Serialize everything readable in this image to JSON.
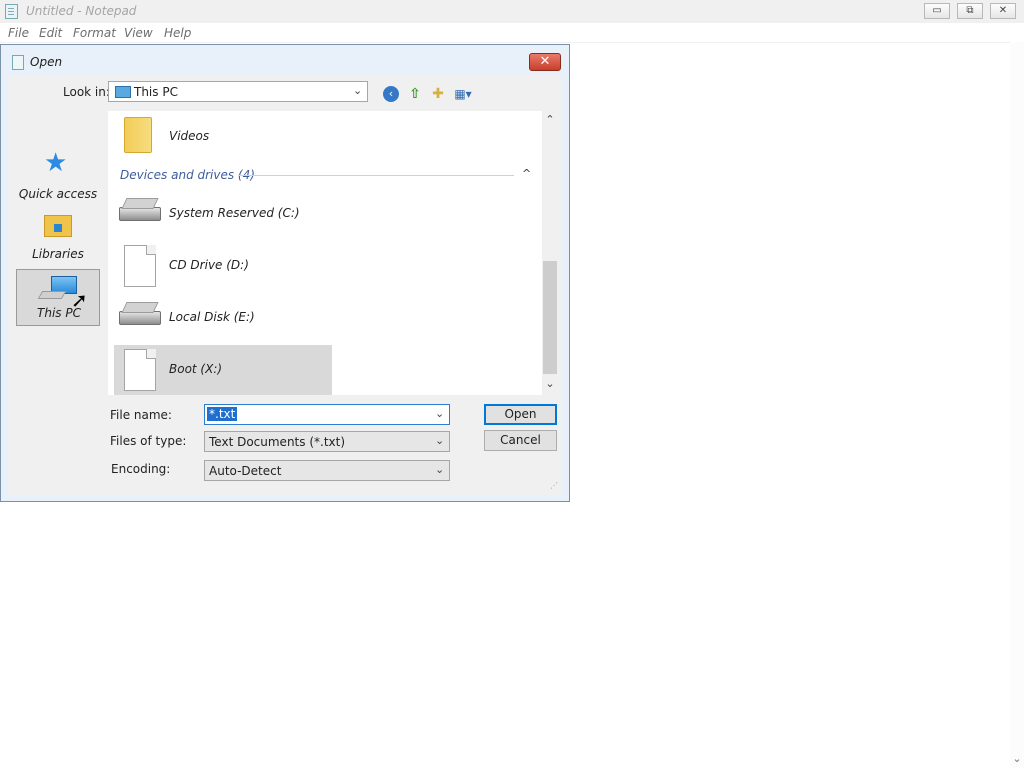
{
  "notepad": {
    "title": "Untitled - Notepad",
    "window_buttons": {
      "minimize": "▭",
      "maximize": "⧉",
      "close": "✕"
    },
    "menu": [
      "File",
      "Edit",
      "Format",
      "View",
      "Help"
    ],
    "scroll_down_glyph": "⌄"
  },
  "dialog": {
    "title": "Open",
    "close_glyph": "✕",
    "look_in": {
      "label": "Look in:",
      "value": "This PC",
      "arrow": "⌄"
    },
    "toolbar_icons": {
      "back": "‹",
      "up": "⇧",
      "new_folder": "✚",
      "views": "▦▾"
    },
    "places": [
      {
        "label": "Quick access",
        "icon": "star-icon"
      },
      {
        "label": "Libraries",
        "icon": "libraries-icon"
      },
      {
        "label": "This PC",
        "icon": "computer-icon",
        "selected": true
      }
    ],
    "items": {
      "videos": "Videos",
      "group_header": "Devices and drives (4)",
      "group_collapse_glyph": "^",
      "drives": [
        {
          "label": "System Reserved (C:)",
          "icon": "hard-drive-icon"
        },
        {
          "label": "CD Drive (D:)",
          "icon": "file-icon"
        },
        {
          "label": "Local Disk (E:)",
          "icon": "hard-drive-icon"
        },
        {
          "label": "Boot (X:)",
          "icon": "file-icon",
          "selected": true
        }
      ]
    },
    "scroll_glyphs": {
      "up": "⌃",
      "down": "⌄"
    },
    "file_name": {
      "label": "File name:",
      "value": "*.txt"
    },
    "files_of_type": {
      "label": "Files of type:",
      "value": "Text Documents (*.txt)"
    },
    "encoding": {
      "label": "Encoding:",
      "value": "Auto-Detect"
    },
    "combo_arrow": "⌄",
    "buttons": {
      "open": "Open",
      "cancel": "Cancel"
    },
    "grip_glyph": "⋰"
  },
  "colors": {
    "selection": "#1f6fd1",
    "group_header": "#3c5d9b",
    "dialog_frame": "#e8f1fa"
  }
}
